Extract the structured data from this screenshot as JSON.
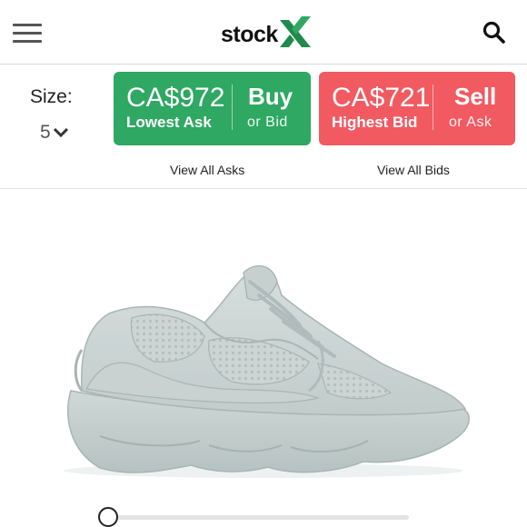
{
  "header": {
    "logo_text": "stock",
    "logo_mark": "X",
    "brand_color": "#1f8a4c",
    "menu_icon": "hamburger-menu-icon",
    "search_icon": "search-icon"
  },
  "size": {
    "label": "Size:",
    "value": "5",
    "icon": "chevron-down-icon"
  },
  "ask": {
    "price": "CA$972",
    "label": "Lowest Ask",
    "action": "Buy",
    "action_sub": "or Bid",
    "color": "#2ea862",
    "link": "View All Asks"
  },
  "bid": {
    "price": "CA$721",
    "label": "Highest Bid",
    "action": "Sell",
    "action_sub": "or Ask",
    "color": "#f15a61",
    "link": "View All Bids"
  },
  "product": {
    "image": "sneaker-image",
    "image_slider_position": 0
  }
}
